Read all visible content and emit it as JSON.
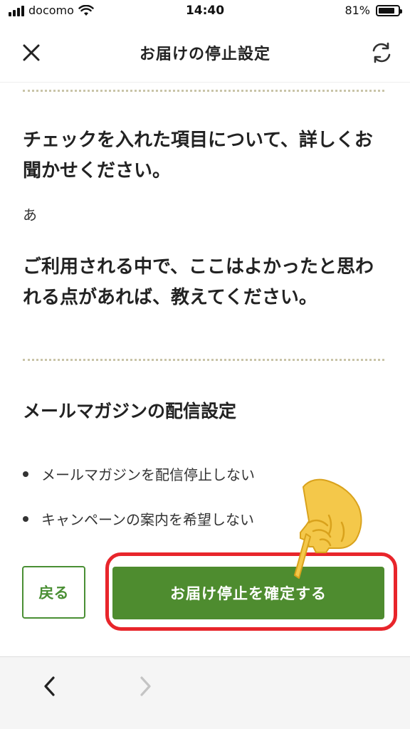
{
  "status_bar": {
    "carrier": "docomo",
    "time": "14:40",
    "battery": "81%",
    "battery_level": 0.81
  },
  "nav": {
    "title": "お届けの停止設定",
    "close_icon": "close-icon",
    "refresh_icon": "refresh-icon"
  },
  "questions": [
    {
      "text": "チェックを入れた項目について、詳しくお聞かせください。",
      "answer": "あ"
    },
    {
      "text": "ご利用される中で、ここはよかったと思われる点があれば、教えてください。",
      "answer": ""
    }
  ],
  "mail_settings": {
    "title": "メールマガジンの配信設定",
    "options": [
      "メールマガジンを配信停止しない",
      "キャンペーンの案内を希望しない"
    ]
  },
  "actions": {
    "back_label": "戻る",
    "confirm_label": "お届け停止を確定する"
  },
  "browser_toolbar": {
    "back_icon": "chevron-left-icon",
    "forward_icon": "chevron-right-icon"
  },
  "colors": {
    "accent_green": "#4e8c2f",
    "highlight_red": "#e8252b",
    "divider": "#c9c4a8"
  }
}
